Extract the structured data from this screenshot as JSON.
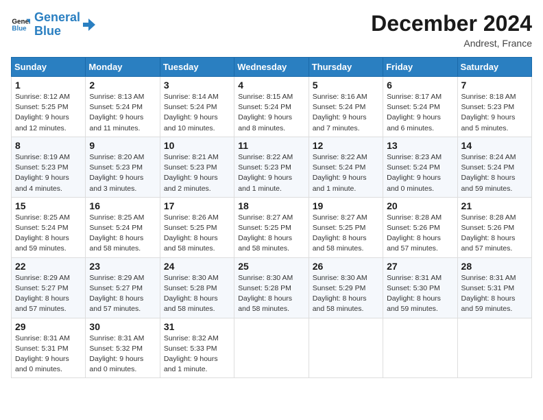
{
  "logo": {
    "line1": "General",
    "line2": "Blue"
  },
  "title": "December 2024",
  "location": "Andrest, France",
  "days_header": [
    "Sunday",
    "Monday",
    "Tuesday",
    "Wednesday",
    "Thursday",
    "Friday",
    "Saturday"
  ],
  "weeks": [
    [
      {
        "day": "1",
        "info": "Sunrise: 8:12 AM\nSunset: 5:25 PM\nDaylight: 9 hours and 12 minutes."
      },
      {
        "day": "2",
        "info": "Sunrise: 8:13 AM\nSunset: 5:24 PM\nDaylight: 9 hours and 11 minutes."
      },
      {
        "day": "3",
        "info": "Sunrise: 8:14 AM\nSunset: 5:24 PM\nDaylight: 9 hours and 10 minutes."
      },
      {
        "day": "4",
        "info": "Sunrise: 8:15 AM\nSunset: 5:24 PM\nDaylight: 9 hours and 8 minutes."
      },
      {
        "day": "5",
        "info": "Sunrise: 8:16 AM\nSunset: 5:24 PM\nDaylight: 9 hours and 7 minutes."
      },
      {
        "day": "6",
        "info": "Sunrise: 8:17 AM\nSunset: 5:24 PM\nDaylight: 9 hours and 6 minutes."
      },
      {
        "day": "7",
        "info": "Sunrise: 8:18 AM\nSunset: 5:23 PM\nDaylight: 9 hours and 5 minutes."
      }
    ],
    [
      {
        "day": "8",
        "info": "Sunrise: 8:19 AM\nSunset: 5:23 PM\nDaylight: 9 hours and 4 minutes."
      },
      {
        "day": "9",
        "info": "Sunrise: 8:20 AM\nSunset: 5:23 PM\nDaylight: 9 hours and 3 minutes."
      },
      {
        "day": "10",
        "info": "Sunrise: 8:21 AM\nSunset: 5:23 PM\nDaylight: 9 hours and 2 minutes."
      },
      {
        "day": "11",
        "info": "Sunrise: 8:22 AM\nSunset: 5:23 PM\nDaylight: 9 hours and 1 minute."
      },
      {
        "day": "12",
        "info": "Sunrise: 8:22 AM\nSunset: 5:24 PM\nDaylight: 9 hours and 1 minute."
      },
      {
        "day": "13",
        "info": "Sunrise: 8:23 AM\nSunset: 5:24 PM\nDaylight: 9 hours and 0 minutes."
      },
      {
        "day": "14",
        "info": "Sunrise: 8:24 AM\nSunset: 5:24 PM\nDaylight: 8 hours and 59 minutes."
      }
    ],
    [
      {
        "day": "15",
        "info": "Sunrise: 8:25 AM\nSunset: 5:24 PM\nDaylight: 8 hours and 59 minutes."
      },
      {
        "day": "16",
        "info": "Sunrise: 8:25 AM\nSunset: 5:24 PM\nDaylight: 8 hours and 58 minutes."
      },
      {
        "day": "17",
        "info": "Sunrise: 8:26 AM\nSunset: 5:25 PM\nDaylight: 8 hours and 58 minutes."
      },
      {
        "day": "18",
        "info": "Sunrise: 8:27 AM\nSunset: 5:25 PM\nDaylight: 8 hours and 58 minutes."
      },
      {
        "day": "19",
        "info": "Sunrise: 8:27 AM\nSunset: 5:25 PM\nDaylight: 8 hours and 58 minutes."
      },
      {
        "day": "20",
        "info": "Sunrise: 8:28 AM\nSunset: 5:26 PM\nDaylight: 8 hours and 57 minutes."
      },
      {
        "day": "21",
        "info": "Sunrise: 8:28 AM\nSunset: 5:26 PM\nDaylight: 8 hours and 57 minutes."
      }
    ],
    [
      {
        "day": "22",
        "info": "Sunrise: 8:29 AM\nSunset: 5:27 PM\nDaylight: 8 hours and 57 minutes."
      },
      {
        "day": "23",
        "info": "Sunrise: 8:29 AM\nSunset: 5:27 PM\nDaylight: 8 hours and 57 minutes."
      },
      {
        "day": "24",
        "info": "Sunrise: 8:30 AM\nSunset: 5:28 PM\nDaylight: 8 hours and 58 minutes."
      },
      {
        "day": "25",
        "info": "Sunrise: 8:30 AM\nSunset: 5:28 PM\nDaylight: 8 hours and 58 minutes."
      },
      {
        "day": "26",
        "info": "Sunrise: 8:30 AM\nSunset: 5:29 PM\nDaylight: 8 hours and 58 minutes."
      },
      {
        "day": "27",
        "info": "Sunrise: 8:31 AM\nSunset: 5:30 PM\nDaylight: 8 hours and 59 minutes."
      },
      {
        "day": "28",
        "info": "Sunrise: 8:31 AM\nSunset: 5:31 PM\nDaylight: 8 hours and 59 minutes."
      }
    ],
    [
      {
        "day": "29",
        "info": "Sunrise: 8:31 AM\nSunset: 5:31 PM\nDaylight: 9 hours and 0 minutes."
      },
      {
        "day": "30",
        "info": "Sunrise: 8:31 AM\nSunset: 5:32 PM\nDaylight: 9 hours and 0 minutes."
      },
      {
        "day": "31",
        "info": "Sunrise: 8:32 AM\nSunset: 5:33 PM\nDaylight: 9 hours and 1 minute."
      },
      null,
      null,
      null,
      null
    ]
  ]
}
